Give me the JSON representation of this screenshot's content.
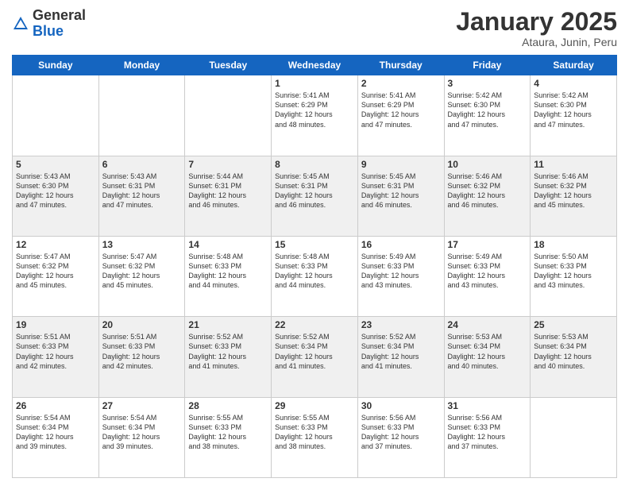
{
  "header": {
    "logo_general": "General",
    "logo_blue": "Blue",
    "month": "January 2025",
    "location": "Ataura, Junin, Peru"
  },
  "days_of_week": [
    "Sunday",
    "Monday",
    "Tuesday",
    "Wednesday",
    "Thursday",
    "Friday",
    "Saturday"
  ],
  "weeks": [
    {
      "shaded": false,
      "days": [
        {
          "num": "",
          "info": ""
        },
        {
          "num": "",
          "info": ""
        },
        {
          "num": "",
          "info": ""
        },
        {
          "num": "1",
          "info": "Sunrise: 5:41 AM\nSunset: 6:29 PM\nDaylight: 12 hours\nand 48 minutes."
        },
        {
          "num": "2",
          "info": "Sunrise: 5:41 AM\nSunset: 6:29 PM\nDaylight: 12 hours\nand 47 minutes."
        },
        {
          "num": "3",
          "info": "Sunrise: 5:42 AM\nSunset: 6:30 PM\nDaylight: 12 hours\nand 47 minutes."
        },
        {
          "num": "4",
          "info": "Sunrise: 5:42 AM\nSunset: 6:30 PM\nDaylight: 12 hours\nand 47 minutes."
        }
      ]
    },
    {
      "shaded": true,
      "days": [
        {
          "num": "5",
          "info": "Sunrise: 5:43 AM\nSunset: 6:30 PM\nDaylight: 12 hours\nand 47 minutes."
        },
        {
          "num": "6",
          "info": "Sunrise: 5:43 AM\nSunset: 6:31 PM\nDaylight: 12 hours\nand 47 minutes."
        },
        {
          "num": "7",
          "info": "Sunrise: 5:44 AM\nSunset: 6:31 PM\nDaylight: 12 hours\nand 46 minutes."
        },
        {
          "num": "8",
          "info": "Sunrise: 5:45 AM\nSunset: 6:31 PM\nDaylight: 12 hours\nand 46 minutes."
        },
        {
          "num": "9",
          "info": "Sunrise: 5:45 AM\nSunset: 6:31 PM\nDaylight: 12 hours\nand 46 minutes."
        },
        {
          "num": "10",
          "info": "Sunrise: 5:46 AM\nSunset: 6:32 PM\nDaylight: 12 hours\nand 46 minutes."
        },
        {
          "num": "11",
          "info": "Sunrise: 5:46 AM\nSunset: 6:32 PM\nDaylight: 12 hours\nand 45 minutes."
        }
      ]
    },
    {
      "shaded": false,
      "days": [
        {
          "num": "12",
          "info": "Sunrise: 5:47 AM\nSunset: 6:32 PM\nDaylight: 12 hours\nand 45 minutes."
        },
        {
          "num": "13",
          "info": "Sunrise: 5:47 AM\nSunset: 6:32 PM\nDaylight: 12 hours\nand 45 minutes."
        },
        {
          "num": "14",
          "info": "Sunrise: 5:48 AM\nSunset: 6:33 PM\nDaylight: 12 hours\nand 44 minutes."
        },
        {
          "num": "15",
          "info": "Sunrise: 5:48 AM\nSunset: 6:33 PM\nDaylight: 12 hours\nand 44 minutes."
        },
        {
          "num": "16",
          "info": "Sunrise: 5:49 AM\nSunset: 6:33 PM\nDaylight: 12 hours\nand 43 minutes."
        },
        {
          "num": "17",
          "info": "Sunrise: 5:49 AM\nSunset: 6:33 PM\nDaylight: 12 hours\nand 43 minutes."
        },
        {
          "num": "18",
          "info": "Sunrise: 5:50 AM\nSunset: 6:33 PM\nDaylight: 12 hours\nand 43 minutes."
        }
      ]
    },
    {
      "shaded": true,
      "days": [
        {
          "num": "19",
          "info": "Sunrise: 5:51 AM\nSunset: 6:33 PM\nDaylight: 12 hours\nand 42 minutes."
        },
        {
          "num": "20",
          "info": "Sunrise: 5:51 AM\nSunset: 6:33 PM\nDaylight: 12 hours\nand 42 minutes."
        },
        {
          "num": "21",
          "info": "Sunrise: 5:52 AM\nSunset: 6:33 PM\nDaylight: 12 hours\nand 41 minutes."
        },
        {
          "num": "22",
          "info": "Sunrise: 5:52 AM\nSunset: 6:34 PM\nDaylight: 12 hours\nand 41 minutes."
        },
        {
          "num": "23",
          "info": "Sunrise: 5:52 AM\nSunset: 6:34 PM\nDaylight: 12 hours\nand 41 minutes."
        },
        {
          "num": "24",
          "info": "Sunrise: 5:53 AM\nSunset: 6:34 PM\nDaylight: 12 hours\nand 40 minutes."
        },
        {
          "num": "25",
          "info": "Sunrise: 5:53 AM\nSunset: 6:34 PM\nDaylight: 12 hours\nand 40 minutes."
        }
      ]
    },
    {
      "shaded": false,
      "days": [
        {
          "num": "26",
          "info": "Sunrise: 5:54 AM\nSunset: 6:34 PM\nDaylight: 12 hours\nand 39 minutes."
        },
        {
          "num": "27",
          "info": "Sunrise: 5:54 AM\nSunset: 6:34 PM\nDaylight: 12 hours\nand 39 minutes."
        },
        {
          "num": "28",
          "info": "Sunrise: 5:55 AM\nSunset: 6:33 PM\nDaylight: 12 hours\nand 38 minutes."
        },
        {
          "num": "29",
          "info": "Sunrise: 5:55 AM\nSunset: 6:33 PM\nDaylight: 12 hours\nand 38 minutes."
        },
        {
          "num": "30",
          "info": "Sunrise: 5:56 AM\nSunset: 6:33 PM\nDaylight: 12 hours\nand 37 minutes."
        },
        {
          "num": "31",
          "info": "Sunrise: 5:56 AM\nSunset: 6:33 PM\nDaylight: 12 hours\nand 37 minutes."
        },
        {
          "num": "",
          "info": ""
        }
      ]
    }
  ]
}
